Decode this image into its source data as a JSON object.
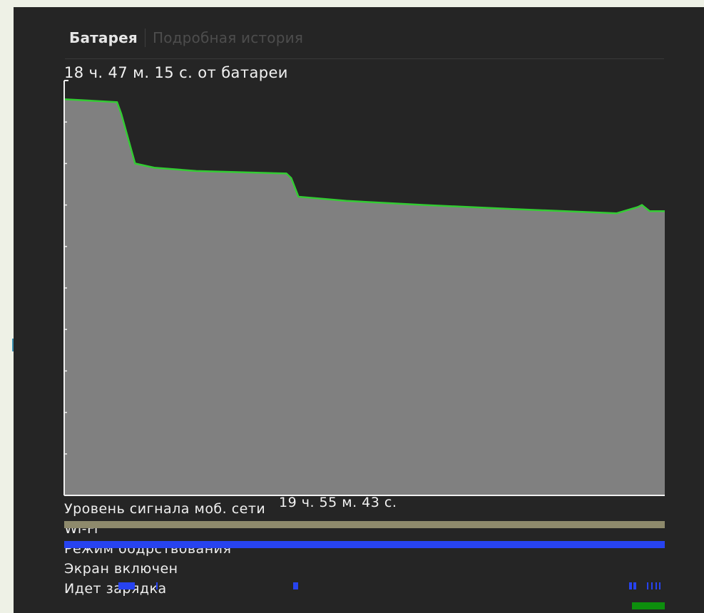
{
  "tabs": {
    "active": "Батарея",
    "inactive": "Подробная история"
  },
  "graph": {
    "caption": "18 ч. 47 м. 15 с. от батареи",
    "end_time_label": "19 ч. 55 м. 43 с.",
    "line_color": "#33cc33",
    "fill_color": "#808080",
    "axis_color": "#f0f0f0"
  },
  "tracks": [
    {
      "id": "signal",
      "label": "Уровень сигнала моб. сети",
      "color": "#8e8a6c"
    },
    {
      "id": "wifi",
      "label": "Wi-Fi",
      "color": "#2743f0"
    },
    {
      "id": "awake",
      "label": "Режим бодрствования",
      "color": "#2743f0"
    },
    {
      "id": "screen",
      "label": "Экран включен",
      "color": "#2743f0"
    },
    {
      "id": "charging",
      "label": "Идет зарядка",
      "color": "#0d8f0d"
    }
  ],
  "chart_data": {
    "type": "area",
    "x_unit": "fraction of elapsed time",
    "y_unit": "fraction of full charge",
    "x": [
      0,
      0.088,
      0.095,
      0.118,
      0.15,
      0.22,
      0.37,
      0.378,
      0.39,
      0.47,
      0.6,
      0.75,
      0.92,
      0.955,
      0.962,
      0.975,
      1.0
    ],
    "y": [
      0.955,
      0.948,
      0.92,
      0.8,
      0.79,
      0.782,
      0.776,
      0.765,
      0.72,
      0.71,
      0.7,
      0.69,
      0.68,
      0.695,
      0.7,
      0.685,
      0.685
    ],
    "screen_on_intervals": [
      [
        0.09,
        0.118
      ],
      [
        0.153,
        0.155
      ],
      [
        0.381,
        0.39
      ],
      [
        0.94,
        0.945
      ],
      [
        0.948,
        0.953
      ],
      [
        0.97,
        0.973
      ],
      [
        0.977,
        0.98
      ],
      [
        0.984,
        0.987
      ],
      [
        0.99,
        0.993
      ]
    ],
    "charging_intervals": [
      [
        0.945,
        1.0
      ]
    ],
    "signal_intervals": [
      [
        0,
        1.0
      ]
    ],
    "wifi_intervals": [
      [
        0,
        1.0
      ]
    ]
  }
}
